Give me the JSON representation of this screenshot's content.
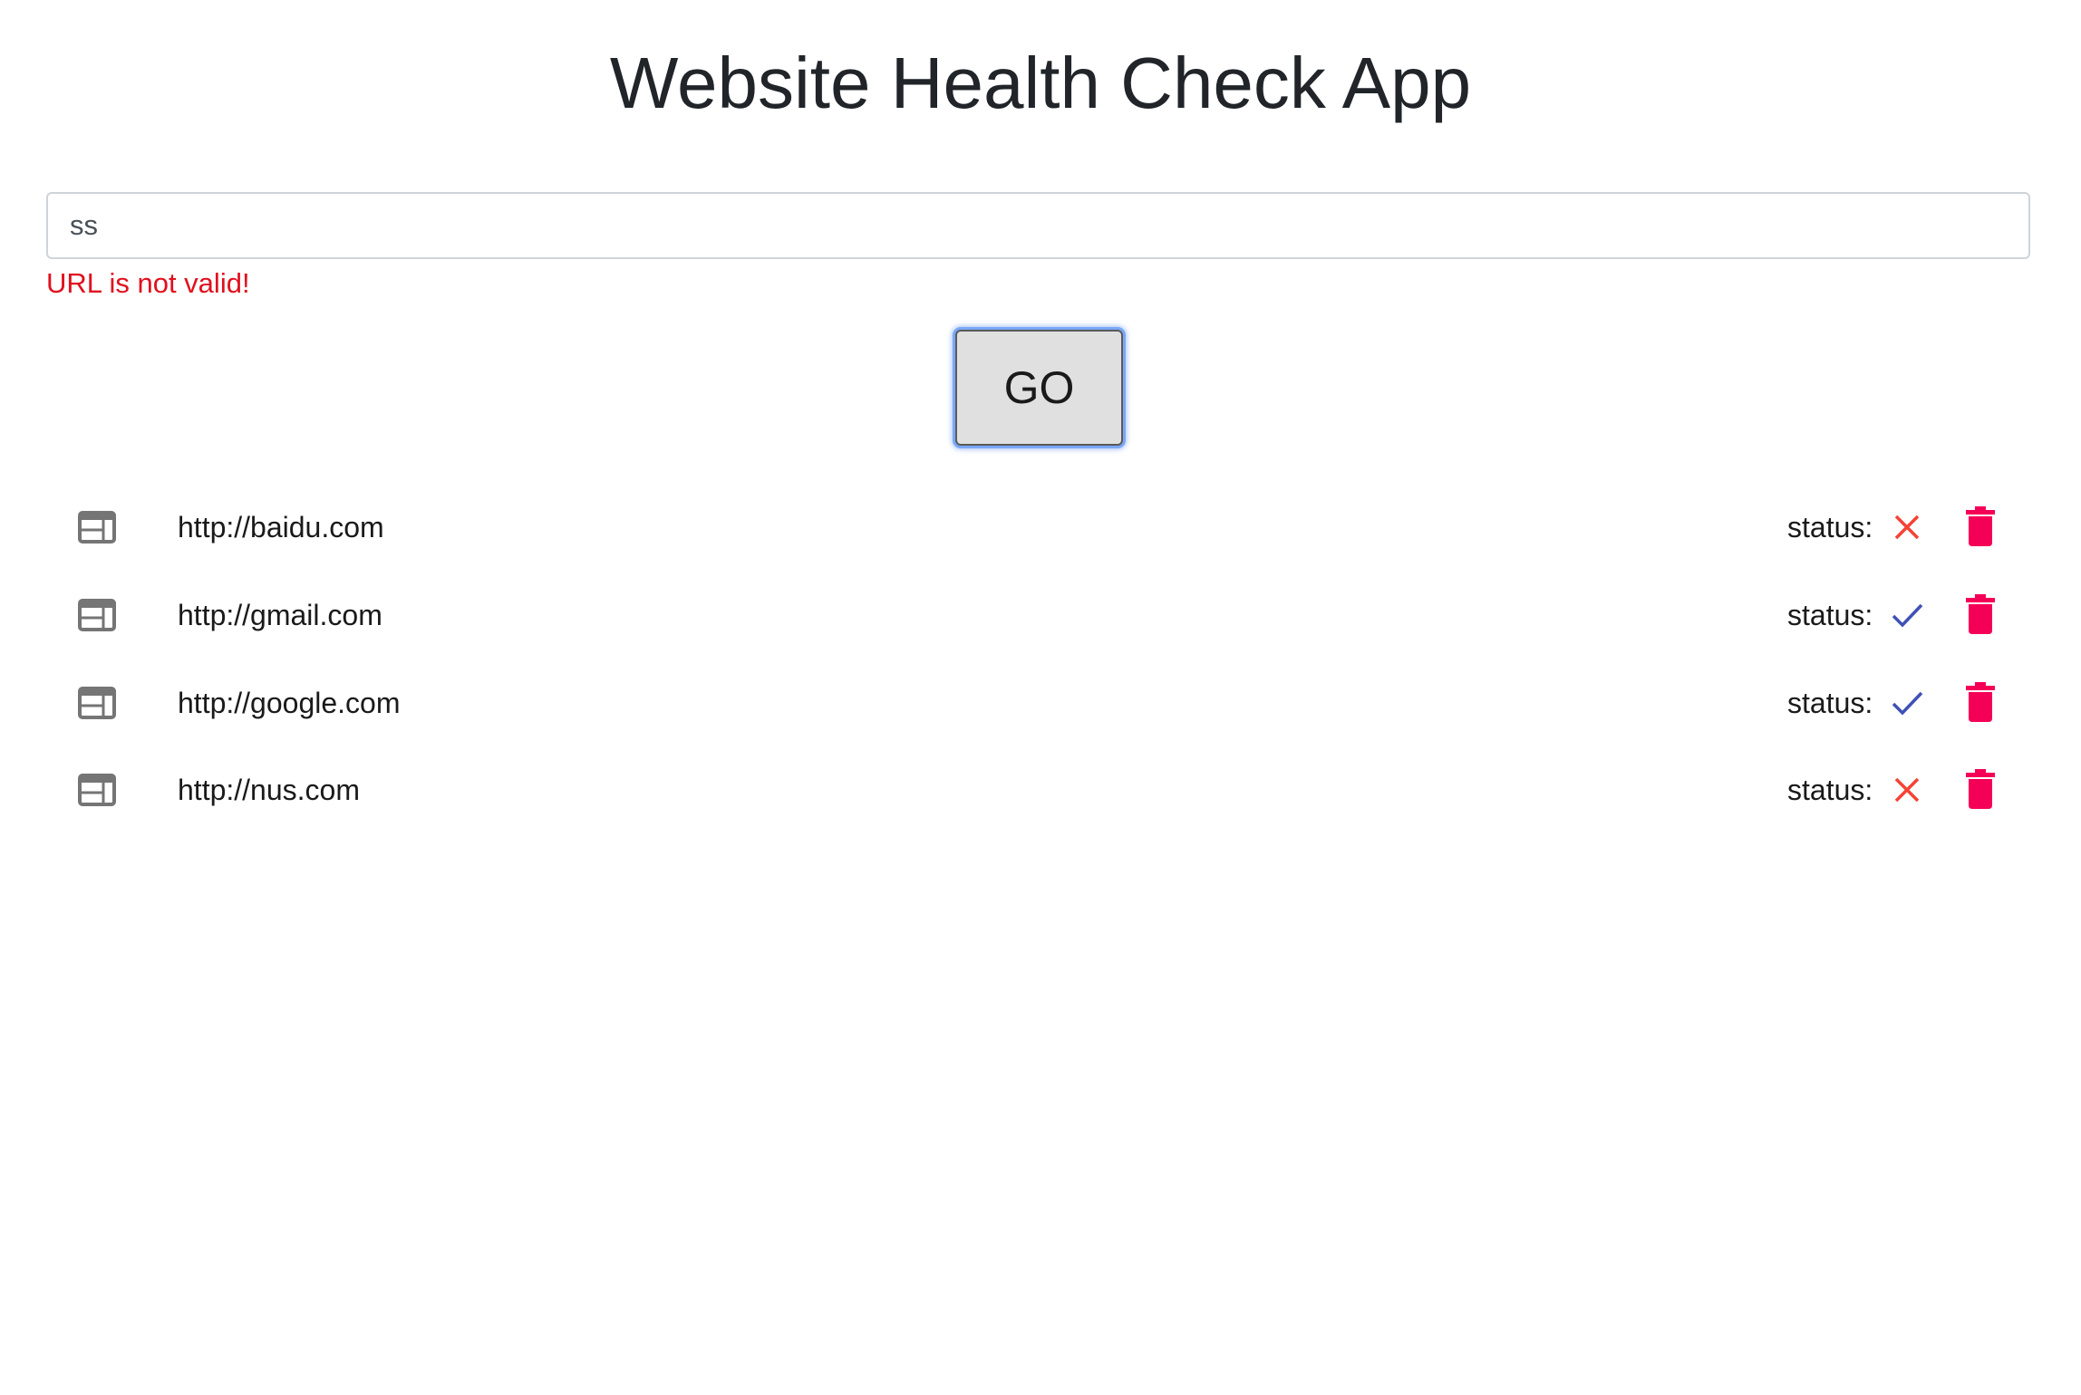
{
  "app": {
    "title": "Website Health Check App"
  },
  "form": {
    "url_value": "ss",
    "error_message": "URL is not valid!",
    "go_label": "GO"
  },
  "sites": [
    {
      "url": "http://baidu.com",
      "status_label": "status:",
      "status": "down",
      "status_icon": "close-icon"
    },
    {
      "url": "http://gmail.com",
      "status_label": "status:",
      "status": "up",
      "status_icon": "check-icon"
    },
    {
      "url": "http://google.com",
      "status_label": "status:",
      "status": "up",
      "status_icon": "check-icon"
    },
    {
      "url": "http://nus.com",
      "status_label": "status:",
      "status": "down",
      "status_icon": "close-icon"
    }
  ],
  "colors": {
    "error": "#e0101e",
    "status_up": "#3f51b5",
    "status_down": "#f44336",
    "delete": "#f50057",
    "site_icon": "#757575"
  }
}
